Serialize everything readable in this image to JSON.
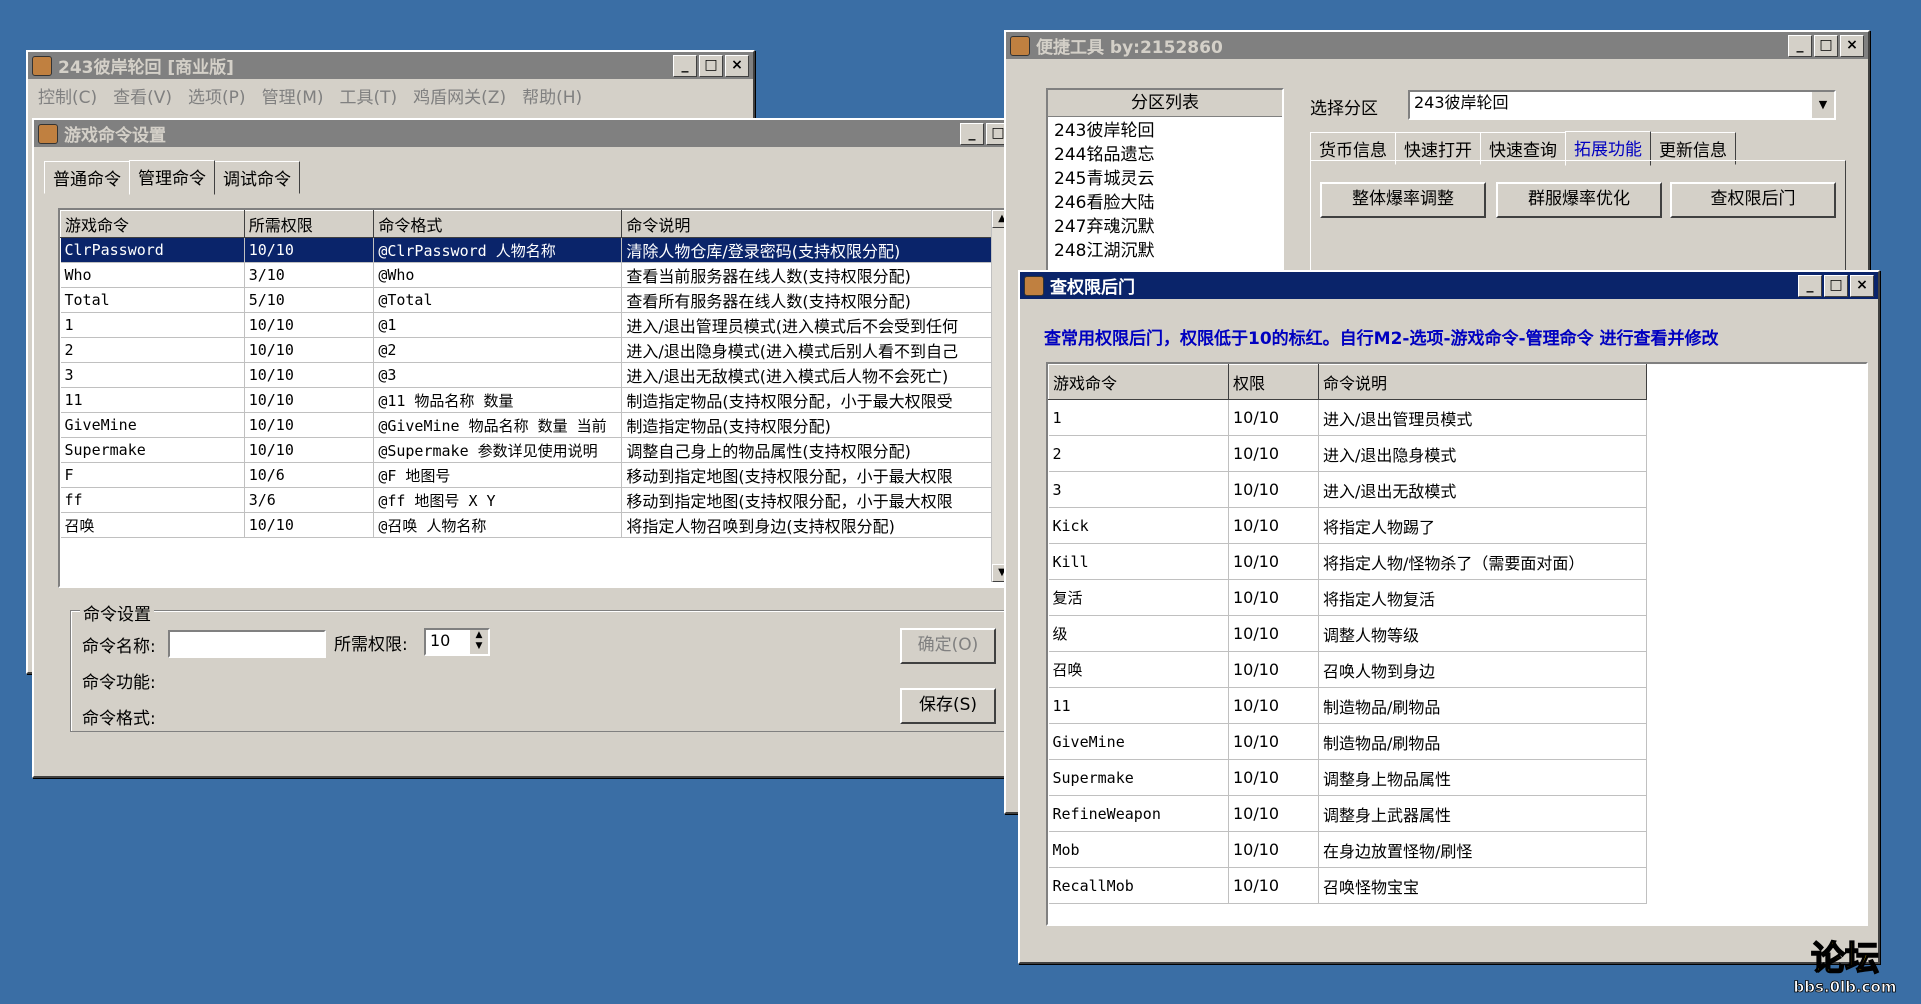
{
  "desktop_bg": "#3a6ea5",
  "main_window": {
    "title": "243彼岸轮回 [商业版]",
    "menu": [
      "控制(C)",
      "查看(V)",
      "选项(P)",
      "管理(M)",
      "工具(T)",
      "鸡盾网关(Z)",
      "帮助(H)"
    ]
  },
  "cmd_window": {
    "title": "游戏命令设置",
    "tabs": [
      "普通命令",
      "管理命令",
      "调试命令"
    ],
    "columns": [
      "游戏命令",
      "所需权限",
      "命令格式",
      "命令说明"
    ],
    "rows": [
      [
        "ClrPassword",
        "10/10",
        "@ClrPassword 人物名称",
        "清除人物仓库/登录密码(支持权限分配)"
      ],
      [
        "Who",
        "3/10",
        "@Who",
        "查看当前服务器在线人数(支持权限分配)"
      ],
      [
        "Total",
        "5/10",
        "@Total",
        "查看所有服务器在线人数(支持权限分配)"
      ],
      [
        "1",
        "10/10",
        "@1",
        "进入/退出管理员模式(进入模式后不会受到任何"
      ],
      [
        "2",
        "10/10",
        "@2",
        "进入/退出隐身模式(进入模式后别人看不到自己"
      ],
      [
        "3",
        "10/10",
        "@3",
        "进入/退出无敌模式(进入模式后人物不会死亡)"
      ],
      [
        "11",
        "10/10",
        "@11 物品名称 数量",
        "制造指定物品(支持权限分配，小于最大权限受"
      ],
      [
        "GiveMine",
        "10/10",
        "@GiveMine 物品名称 数量 当前",
        "制造指定物品(支持权限分配)"
      ],
      [
        "Supermake",
        "10/10",
        "@Supermake 参数详见使用说明",
        "调整自己身上的物品属性(支持权限分配)"
      ],
      [
        "F",
        "10/6",
        "@F 地图号",
        "移动到指定地图(支持权限分配，小于最大权限"
      ],
      [
        "ff",
        "3/6",
        "@ff 地图号 X Y",
        "移动到指定地图(支持权限分配，小于最大权限"
      ],
      [
        "召唤",
        "10/10",
        "@召唤 人物名称",
        "将指定人物召唤到身边(支持权限分配)"
      ]
    ],
    "group_title": "命令设置",
    "name_label": "命令名称:",
    "name_value": "",
    "perm_label": "所需权限:",
    "perm_value": "10",
    "func_label": "命令功能:",
    "format_label": "命令格式:",
    "ok_button": "确定(O)",
    "save_button": "保存(S)"
  },
  "tool_window": {
    "title": "便捷工具  by:2152860",
    "list_header": "分区列表",
    "list_items": [
      "243彼岸轮回",
      "244铭品遗忘",
      "245青城灵云",
      "246看脸大陆",
      "247弃魂沉默",
      "248江湖沉默"
    ],
    "select_label": "选择分区",
    "select_value": "243彼岸轮回",
    "tabs": [
      "货币信息",
      "快速打开",
      "快速查询",
      "拓展功能",
      "更新信息"
    ],
    "buttons": [
      "整体爆率调整",
      "群服爆率优化",
      "查权限后门"
    ]
  },
  "perm_window": {
    "title": "查权限后门",
    "note": "查常用权限后门，权限低于10的标红。自行M2-选项-游戏命令-管理命令 进行查看并修改",
    "columns": [
      "游戏命令",
      "权限",
      "命令说明"
    ],
    "rows": [
      [
        "1",
        "10/10",
        "进入/退出管理员模式"
      ],
      [
        "2",
        "10/10",
        "进入/退出隐身模式"
      ],
      [
        "3",
        "10/10",
        "进入/退出无敌模式"
      ],
      [
        "Kick",
        "10/10",
        "将指定人物踢了"
      ],
      [
        "Kill",
        "10/10",
        "将指定人物/怪物杀了（需要面对面）"
      ],
      [
        "复活",
        "10/10",
        "将指定人物复活"
      ],
      [
        "级",
        "10/10",
        "调整人物等级"
      ],
      [
        "召唤",
        "10/10",
        "召唤人物到身边"
      ],
      [
        "11",
        "10/10",
        "制造物品/刷物品"
      ],
      [
        "GiveMine",
        "10/10",
        "制造物品/刷物品"
      ],
      [
        "Supermake",
        "10/10",
        "调整身上物品属性"
      ],
      [
        "RefineWeapon",
        "10/10",
        "调整身上武器属性"
      ],
      [
        "Mob",
        "10/10",
        "在身边放置怪物/刷怪"
      ],
      [
        "RecallMob",
        "10/10",
        "召唤怪物宝宝"
      ]
    ]
  },
  "watermark": {
    "text": "论坛",
    "url": "bbs.0lb.com"
  }
}
